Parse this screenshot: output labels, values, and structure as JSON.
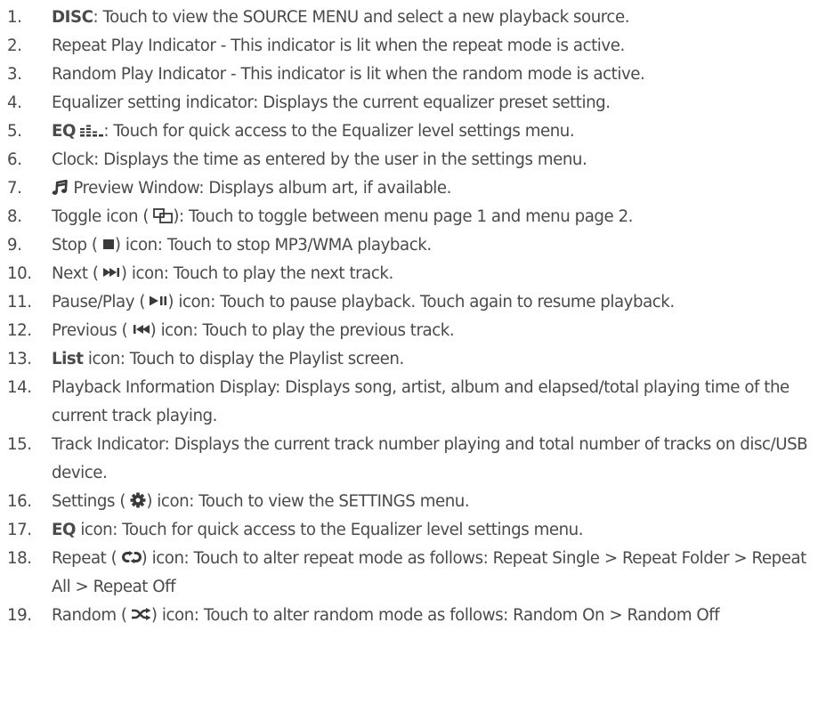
{
  "items": [
    {
      "num": "1.",
      "bold": "DISC",
      "text": ": Touch to view the SOURCE MENU and select a new playback source."
    },
    {
      "num": "2.",
      "text": "Repeat Play Indicator - This indicator is lit when the repeat mode is active."
    },
    {
      "num": "3.",
      "text": "Random Play Indicator - This indicator is lit when the random mode is active."
    },
    {
      "num": "4.",
      "text": "Equalizer setting indicator: Displays the current equalizer preset setting."
    },
    {
      "num": "5.",
      "bold": "EQ",
      "icon": "equalizer-bars-icon",
      "text": ": Touch for quick access to the Equalizer level settings menu."
    },
    {
      "num": "6.",
      "text": "Clock: Displays the time as entered by the user in the settings menu."
    },
    {
      "num": "7.",
      "icon": "music-note-icon",
      "text": " Preview Window: Displays album art, if available."
    },
    {
      "num": "8.",
      "before": "Toggle icon (",
      "icon": "toggle-windows-icon",
      "after": "): Touch to toggle between menu page 1 and menu page 2."
    },
    {
      "num": "9.",
      "before": "Stop (",
      "icon": "stop-icon",
      "after": ") icon: Touch to stop MP3/WMA playback."
    },
    {
      "num": "10.",
      "before": "Next (",
      "icon": "next-track-icon",
      "after": ") icon: Touch to play the next track."
    },
    {
      "num": "11.",
      "before": "Pause/Play (",
      "icon": "play-pause-icon",
      "after": ") icon: Touch to pause playback. Touch again to resume playback."
    },
    {
      "num": "12.",
      "before": "Previous (",
      "icon": "previous-track-icon",
      "after": ") icon: Touch to play the previous track."
    },
    {
      "num": "13.",
      "bold": "List",
      "text": " icon: Touch to display the Playlist screen."
    },
    {
      "num": "14.",
      "text": "Playback Information Display: Displays song, artist, album and elapsed/total playing time of the current track playing."
    },
    {
      "num": "15.",
      "text": "Track Indicator: Displays the current track number playing and total number of tracks on disc/USB device."
    },
    {
      "num": "16.",
      "before": "Settings (",
      "icon": "gear-icon",
      "after": ") icon: Touch to view the SETTINGS menu."
    },
    {
      "num": "17.",
      "bold": "EQ",
      "text": " icon: Touch for quick access to the Equalizer level settings menu."
    },
    {
      "num": "18.",
      "before": "Repeat (",
      "icon": "repeat-icon",
      "after": ") icon: Touch to alter repeat mode as follows: Repeat Single > Repeat Folder > Repeat All > Repeat Off"
    },
    {
      "num": "19.",
      "before": "Random (",
      "icon": "shuffle-icon",
      "after": ") icon: Touch to alter random mode as follows: Random On > Random Off"
    }
  ],
  "colors": {
    "text": "#4a4a4a",
    "icon": "#3a3a3a",
    "background": "#ffffff"
  }
}
